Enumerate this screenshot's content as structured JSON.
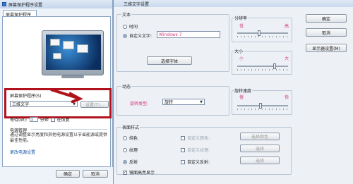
{
  "left_window": {
    "title": "屏幕保护程序设置",
    "tab_label": "屏幕保护程序",
    "screensaver_label": "屏幕保护程序(S)",
    "screensaver_value": "三维文字",
    "settings_button": "设置(T)...",
    "wait_label": "等待(W):",
    "wait_value": "1",
    "wait_unit": "分钟",
    "resume_label": "在恢复",
    "power_title": "电源管理",
    "power_text": "通过调整显示亮度和其他电源设置以节省能源或提供最佳性能。",
    "power_link": "更改电源设置",
    "ok_button": "确定",
    "cancel_button": "取消"
  },
  "right_window": {
    "title": "三维文字设置",
    "text_group": "文本",
    "time_option": "时间",
    "custom_text_option": "自定义文字:",
    "custom_text_value": "Windows 7",
    "choose_font_button": "选择字体",
    "resolution_group": "分辨率",
    "low": "低",
    "high": "高",
    "size_group": "大小",
    "small": "小",
    "large": "大",
    "motion_group": "动态",
    "rotation_type_label": "旋转类型:",
    "rotation_type_value": "旋转",
    "rotation_speed_group": "旋转速度",
    "slow": "慢",
    "fast": "快",
    "surface_group": "表面样式",
    "solid_color_option": "纯色",
    "texture_option": "纹理",
    "reflection_option": "反射",
    "custom_color_check": "自定义颜色:",
    "custom_texture_check": "自定义纹理:",
    "custom_reflection_check": "自定义反射:",
    "choose_color_button": "选择颜色",
    "choose_texture_button": "选择",
    "choose_reflection_button": "选择",
    "highlight_check": "镜面高亮显示",
    "ok_button": "确定",
    "cancel_button": "取消",
    "display_settings_button": "显示器设置(M)",
    "resolution_level": 0.42,
    "size_level": 0.75,
    "speed_level": 0.45,
    "pink_color": "#d4387e",
    "red_annotation_color": "#b1121b"
  }
}
